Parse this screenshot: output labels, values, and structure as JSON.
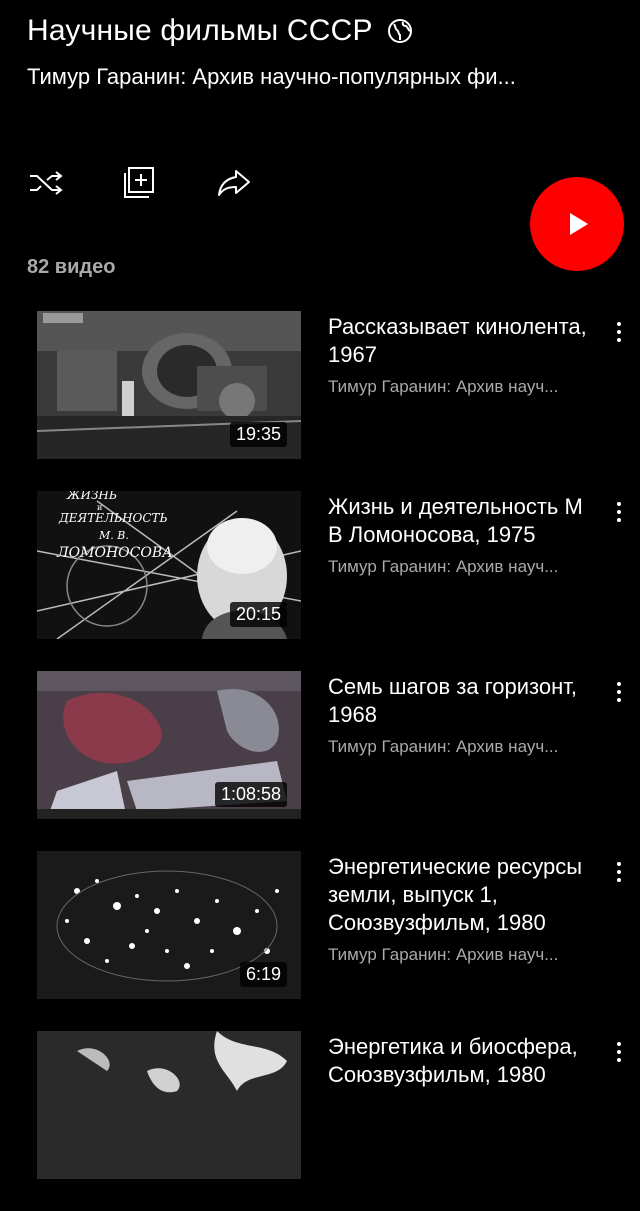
{
  "header": {
    "title": "Научные фильмы СССР",
    "visibility_icon": "globe-icon",
    "subtitle": "Тимур Гаранин: Архив научно-популярных фи..."
  },
  "actions": [
    {
      "name": "shuffle-icon"
    },
    {
      "name": "add-to-playlist-icon"
    },
    {
      "name": "share-icon"
    }
  ],
  "play_button": {
    "icon": "play-icon",
    "color": "#ff0000"
  },
  "video_count": "82 видео",
  "videos": [
    {
      "title": "Рассказывает кинолента, 1967",
      "channel": "Тимур Гаранин: Архив науч...",
      "duration": "19:35"
    },
    {
      "title": "Жизнь и деятельность М В  Ломоносова, 1975",
      "channel": "Тимур Гаранин: Архив науч...",
      "duration": "20:15",
      "thumb_text": [
        "ЖИЗНЬ",
        "и",
        "ДЕЯТЕЛЬНОСТЬ",
        "М. В.",
        "ЛОМОНОСОВА"
      ]
    },
    {
      "title": "Семь шагов за горизонт, 1968",
      "channel": "Тимур Гаранин: Архив науч...",
      "duration": "1:08:58"
    },
    {
      "title": "Энергетические ресурсы земли, выпуск 1, Союзвузфильм, 1980",
      "channel": "Тимур Гаранин: Архив науч...",
      "duration": "6:19"
    },
    {
      "title": "Энергетика и биосфера, Союзвузфильм, 1980",
      "channel": "",
      "duration": ""
    }
  ]
}
